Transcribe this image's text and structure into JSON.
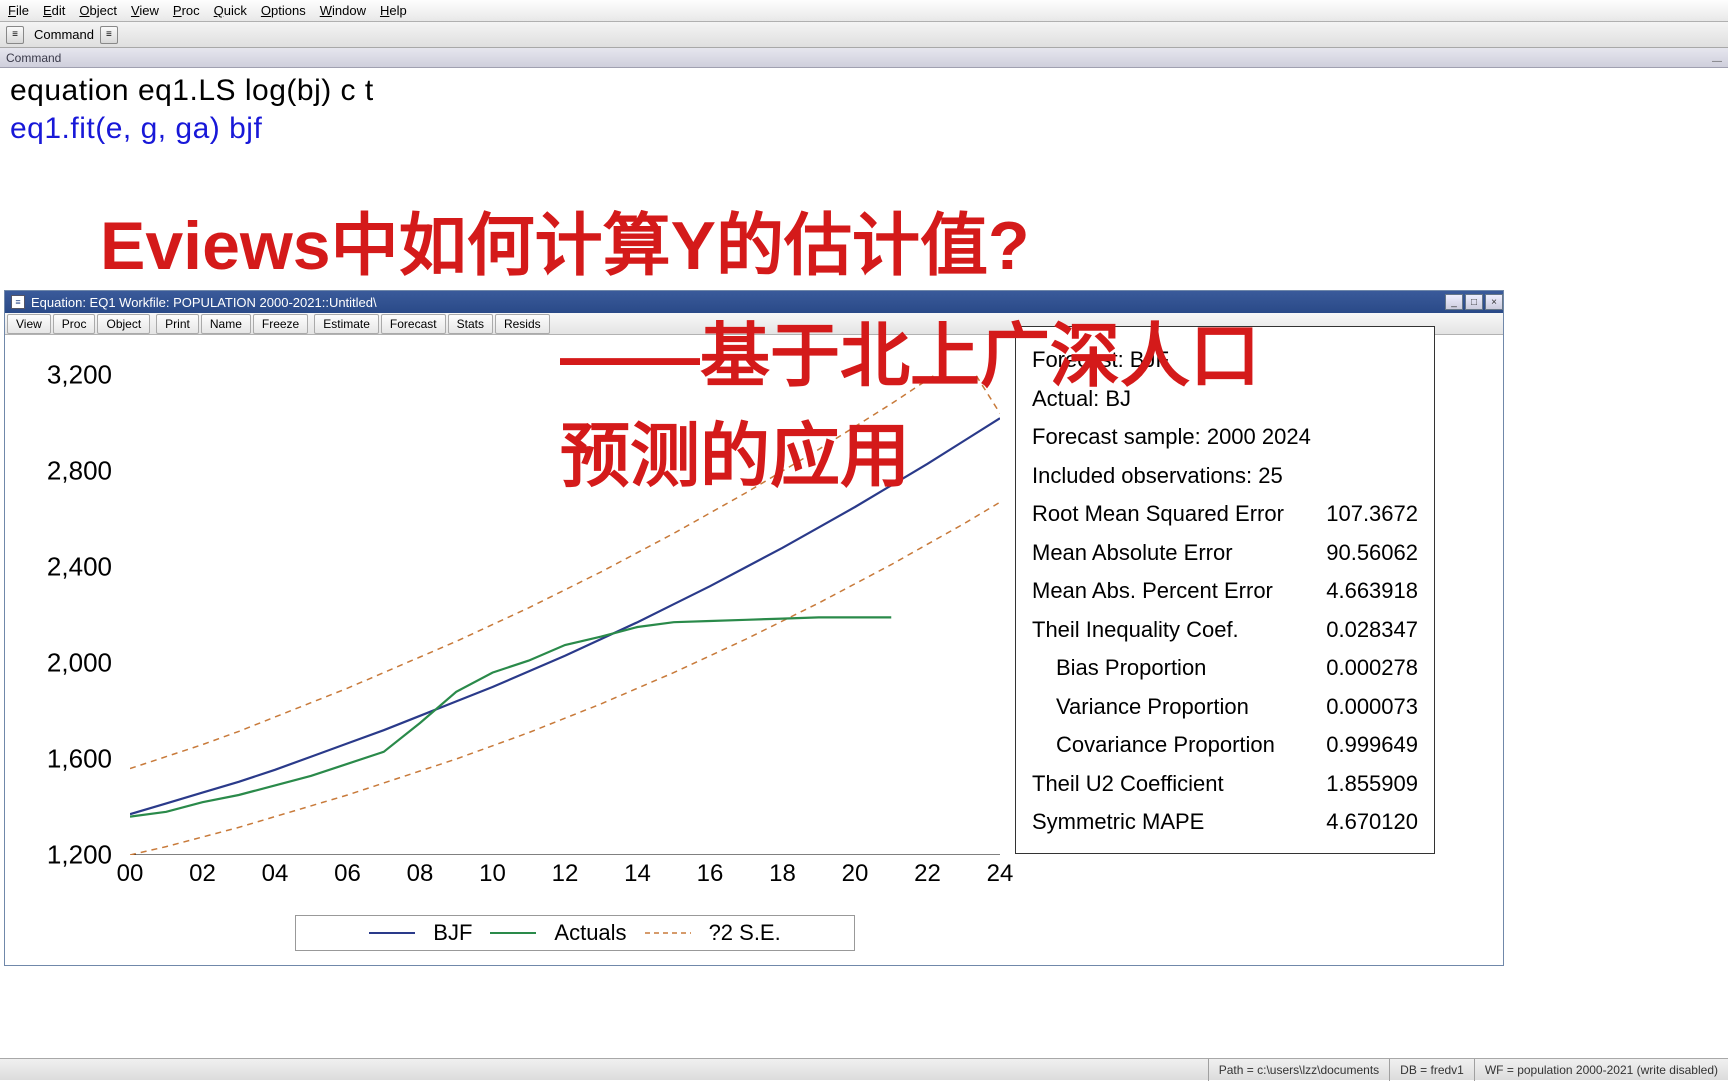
{
  "menubar": [
    "File",
    "Edit",
    "Object",
    "View",
    "Proc",
    "Quick",
    "Options",
    "Window",
    "Help"
  ],
  "toolbar_label": "Command",
  "command_label": "Command",
  "editor": {
    "line1": "equation eq1.LS log(bj) c t",
    "line2": "eq1.fit(e, g, ga) bjf"
  },
  "overlay": {
    "t1": "Eviews中如何计算Y的估计值?",
    "t2": "——基于北上广深人口",
    "t3": "预测的应用"
  },
  "eqwin": {
    "title": "Equation: EQ1   Workfile: POPULATION 2000-2021::Untitled\\",
    "toolbar": [
      "View",
      "Proc",
      "Object",
      "Print",
      "Name",
      "Freeze",
      "Estimate",
      "Forecast",
      "Stats",
      "Resids"
    ]
  },
  "chart_data": {
    "type": "line",
    "x": [
      2000,
      2001,
      2002,
      2003,
      2004,
      2005,
      2006,
      2007,
      2008,
      2009,
      2010,
      2011,
      2012,
      2013,
      2014,
      2015,
      2016,
      2017,
      2018,
      2019,
      2020,
      2021,
      2022,
      2023,
      2024
    ],
    "series": [
      {
        "name": "BJF",
        "values": [
          1370,
          1415,
          1460,
          1505,
          1555,
          1610,
          1665,
          1720,
          1780,
          1840,
          1900,
          1965,
          2030,
          2100,
          2170,
          2245,
          2320,
          2400,
          2480,
          2565,
          2650,
          2740,
          2830,
          2925,
          3020
        ]
      },
      {
        "name": "Actuals",
        "values": [
          1360,
          1380,
          1420,
          1450,
          1490,
          1530,
          1580,
          1630,
          1750,
          1880,
          1960,
          2010,
          2075,
          2110,
          2150,
          2170,
          2175,
          2180,
          2185,
          2190,
          2190,
          2190,
          null,
          null,
          null
        ]
      },
      {
        "name": "?2 S.E. upper",
        "values": [
          1560,
          1610,
          1660,
          1715,
          1775,
          1835,
          1895,
          1960,
          2025,
          2090,
          2160,
          2230,
          2305,
          2380,
          2460,
          2540,
          2625,
          2710,
          2800,
          2890,
          2985,
          3080,
          3180,
          3280,
          3040
        ]
      },
      {
        "name": "?2 S.E. lower",
        "values": [
          1200,
          1235,
          1275,
          1315,
          1360,
          1405,
          1450,
          1500,
          1550,
          1600,
          1655,
          1710,
          1770,
          1830,
          1895,
          1960,
          2030,
          2100,
          2175,
          2250,
          2330,
          2410,
          2495,
          2580,
          2670
        ]
      }
    ],
    "ylim": [
      1200,
      3200
    ],
    "yticks": [
      1200,
      1600,
      2000,
      2400,
      2800,
      3200
    ],
    "xticks": [
      "00",
      "02",
      "04",
      "06",
      "08",
      "10",
      "12",
      "14",
      "16",
      "18",
      "20",
      "22",
      "24"
    ],
    "legend": [
      "BJF",
      "Actuals",
      "?2 S.E."
    ]
  },
  "stats": {
    "h1": "Forecast: BJF",
    "h2": "Actual: BJ",
    "h3": "Forecast sample: 2000 2024",
    "h4": "Included observations: 25",
    "rows": [
      {
        "l": "Root Mean Squared Error",
        "v": "107.3672"
      },
      {
        "l": "Mean Absolute Error",
        "v": "90.56062"
      },
      {
        "l": "Mean Abs. Percent Error",
        "v": "4.663918"
      },
      {
        "l": "Theil Inequality Coef.",
        "v": "0.028347"
      },
      {
        "l": "Bias Proportion",
        "v": "0.000278",
        "indent": true
      },
      {
        "l": "Variance Proportion",
        "v": "0.000073",
        "indent": true
      },
      {
        "l": "Covariance Proportion",
        "v": "0.999649",
        "indent": true
      },
      {
        "l": "Theil U2 Coefficient",
        "v": "1.855909"
      },
      {
        "l": "Symmetric MAPE",
        "v": "4.670120"
      }
    ]
  },
  "statusbar": {
    "path": "Path = c:\\users\\lzz\\documents",
    "db": "DB = fredv1",
    "wf": "WF = population 2000-2021 (write disabled)"
  }
}
